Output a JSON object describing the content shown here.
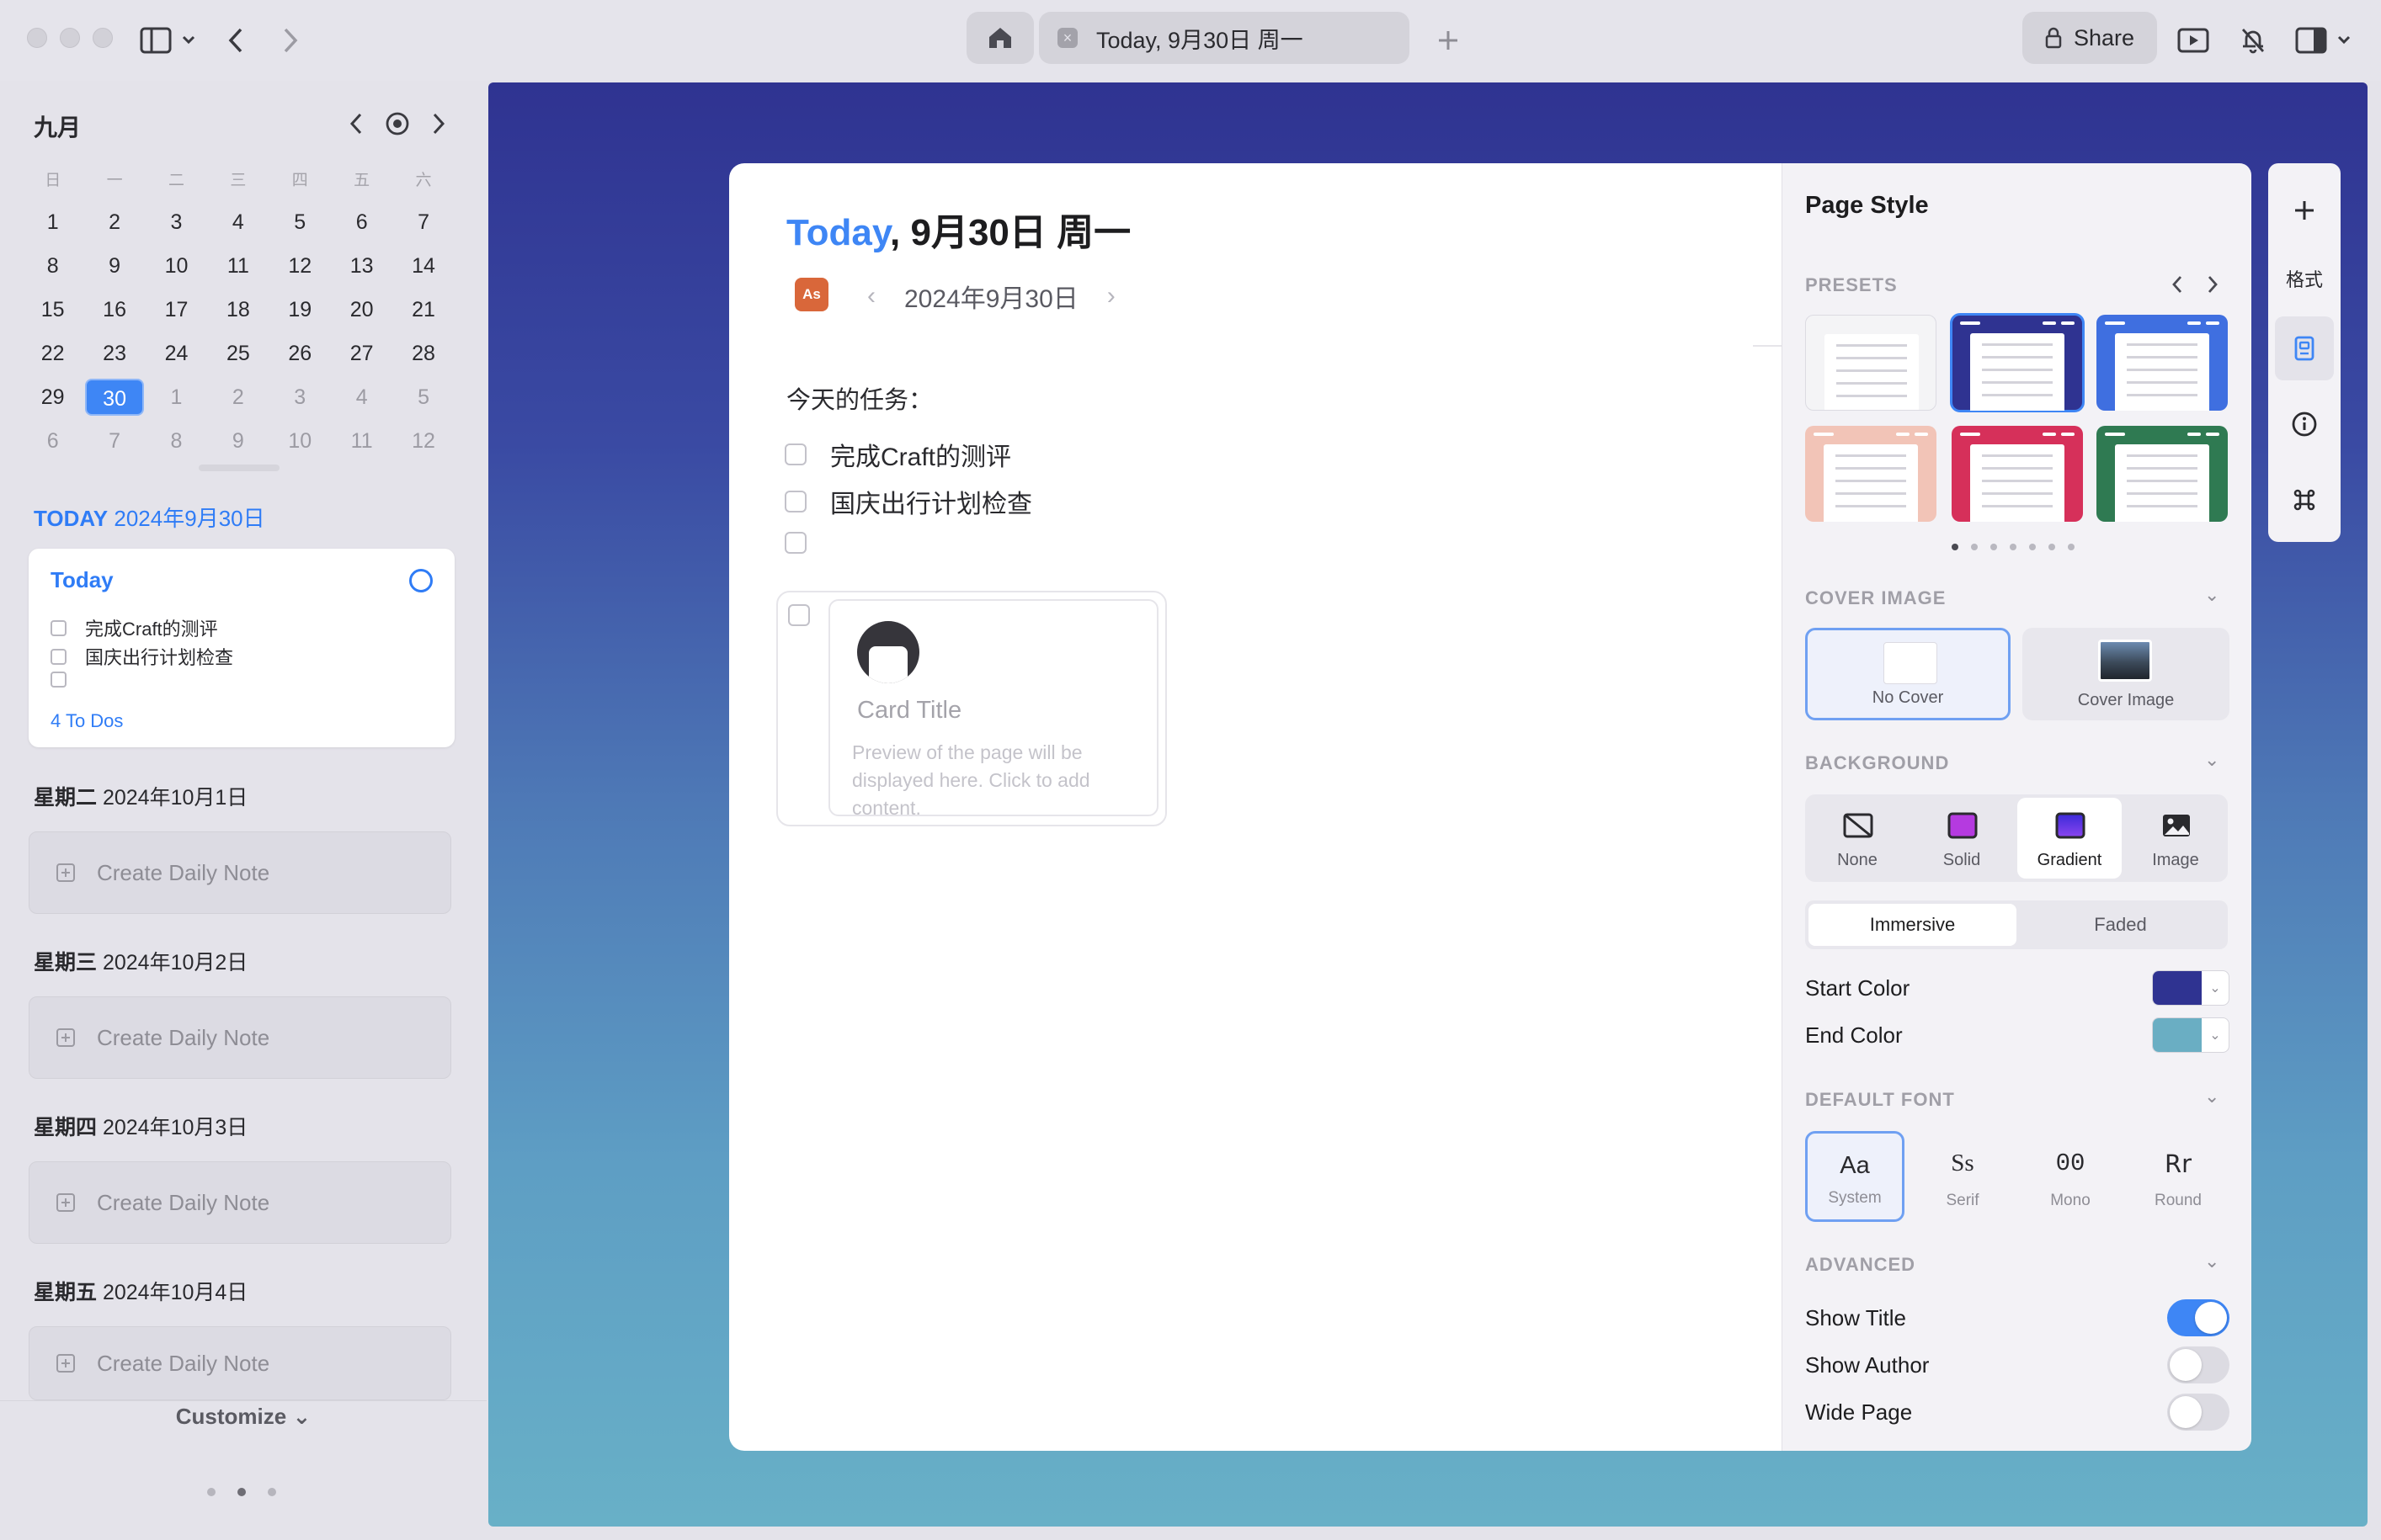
{
  "window": {
    "tab_title": "Today, 9月30日 周一",
    "tab_close": "×",
    "share_label": "Share"
  },
  "calendar": {
    "month": "九月",
    "weekdays": [
      "日",
      "一",
      "二",
      "三",
      "四",
      "五",
      "六"
    ],
    "weeks": [
      [
        "1",
        "2",
        "3",
        "4",
        "5",
        "6",
        "7"
      ],
      [
        "8",
        "9",
        "10",
        "11",
        "12",
        "13",
        "14"
      ],
      [
        "15",
        "16",
        "17",
        "18",
        "19",
        "20",
        "21"
      ],
      [
        "22",
        "23",
        "24",
        "25",
        "26",
        "27",
        "28"
      ],
      [
        "29",
        "30",
        "1",
        "2",
        "3",
        "4",
        "5"
      ],
      [
        "6",
        "7",
        "8",
        "9",
        "10",
        "11",
        "12"
      ]
    ],
    "selected": "30"
  },
  "sidebar": {
    "today_header": {
      "prefix": "TODAY",
      "date": "2024年9月30日"
    },
    "today_card": {
      "title": "Today",
      "todos": [
        "完成Craft的测评",
        "国庆出行计划检查",
        ""
      ],
      "count": "4 To Dos"
    },
    "upcoming": [
      {
        "weekday": "星期二",
        "date": "2024年10月1日",
        "action": "Create Daily Note"
      },
      {
        "weekday": "星期三",
        "date": "2024年10月2日",
        "action": "Create Daily Note"
      },
      {
        "weekday": "星期四",
        "date": "2024年10月3日",
        "action": "Create Daily Note"
      },
      {
        "weekday": "星期五",
        "date": "2024年10月4日",
        "action": "Create Daily Note"
      }
    ],
    "customize_label": "Customize ⌄"
  },
  "document": {
    "title_today": "Today",
    "title_rest": ", 9月30日 周一",
    "author_initials": "As",
    "date": "2024年9月30日",
    "heading": "今天的任务：",
    "todos": [
      "完成Craft的测评",
      "国庆出行计划检查",
      ""
    ],
    "card": {
      "title": "Card Title",
      "preview": "Preview of the page will be displayed here. Click to add content."
    }
  },
  "page_style": {
    "title": "Page Style",
    "sections": {
      "presets": "PRESETS",
      "cover": "COVER IMAGE",
      "background": "BACKGROUND",
      "font": "DEFAULT FONT",
      "advanced": "ADVANCED"
    },
    "presets": [
      {
        "bg": "#f4f4f6",
        "selected": false
      },
      {
        "bg": "#2f3391",
        "selected": true
      },
      {
        "bg": "#3f6fe0",
        "selected": false
      },
      {
        "bg": "#f2c4b7",
        "selected": false
      },
      {
        "bg": "#d6305a",
        "selected": false
      },
      {
        "bg": "#2f7a52",
        "selected": false
      }
    ],
    "cover_options": [
      "No Cover",
      "Cover Image"
    ],
    "background_options": [
      "None",
      "Solid",
      "Gradient",
      "Image"
    ],
    "background_selected": "Gradient",
    "modes": [
      "Immersive",
      "Faded"
    ],
    "mode_selected": "Immersive",
    "start_color": {
      "label": "Start Color",
      "value": "#2f3391"
    },
    "end_color": {
      "label": "End Color",
      "value": "#6aaec3"
    },
    "fonts": [
      {
        "glyph": "Aa",
        "name": "System"
      },
      {
        "glyph": "Ss",
        "name": "Serif"
      },
      {
        "glyph": "00",
        "name": "Mono"
      },
      {
        "glyph": "Rr",
        "name": "Round"
      }
    ],
    "font_selected": "System",
    "advanced": [
      {
        "label": "Show Title",
        "on": true
      },
      {
        "label": "Show Author",
        "on": false
      },
      {
        "label": "Wide Page",
        "on": false
      }
    ]
  },
  "tools": {
    "format_label": "格式"
  },
  "colors": {
    "accent": "#3e86f5",
    "gradient_top": "#2f3391",
    "gradient_bottom": "#68b0c7"
  }
}
